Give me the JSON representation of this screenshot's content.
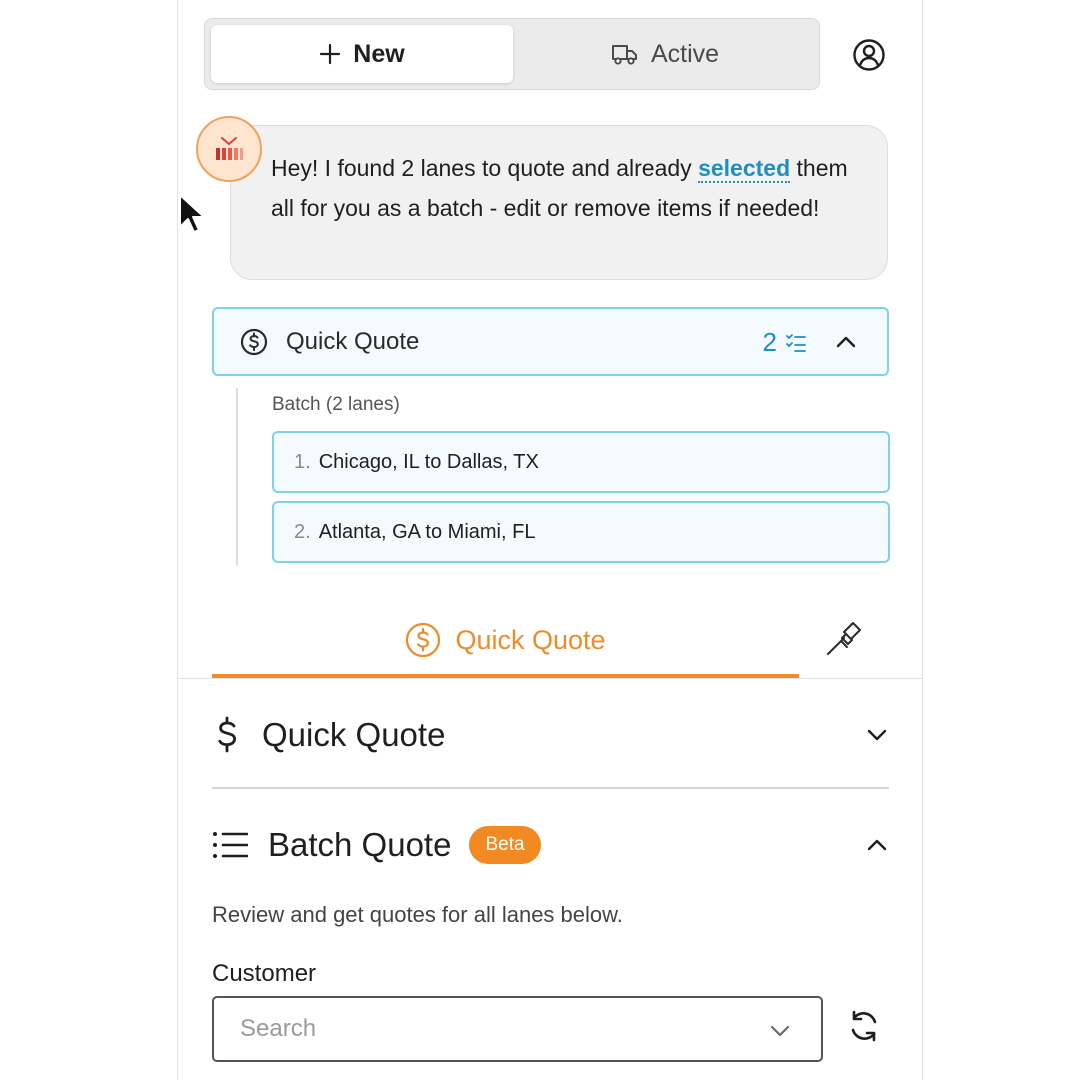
{
  "header": {
    "new_label": "New",
    "active_label": "Active"
  },
  "chat": {
    "message_before": "Hey! I found 2 lanes to quote and already ",
    "message_link": "selected",
    "message_after": " them all for you as a batch - edit or remove items if needed!"
  },
  "quick_quote_card": {
    "label": "Quick Quote",
    "count": "2"
  },
  "batch": {
    "label": "Batch (2 lanes)",
    "lanes": [
      {
        "num": "1.",
        "route": "Chicago, IL to Dallas, TX"
      },
      {
        "num": "2.",
        "route": "Atlanta, GA to Miami, FL"
      }
    ]
  },
  "tabs": {
    "quick_quote_label": "Quick Quote",
    "active_color": "#ef8c2a"
  },
  "sections": {
    "quick_quote_title": "Quick Quote",
    "batch_quote_title": "Batch Quote",
    "beta_badge": "Beta",
    "description": "Review and get quotes for all lanes below.",
    "customer_label": "Customer",
    "search_placeholder": "Search"
  },
  "colors": {
    "accent_orange": "#ef8c2a",
    "accent_blue": "#1f8fc0",
    "card_border": "#7fd0ea"
  }
}
